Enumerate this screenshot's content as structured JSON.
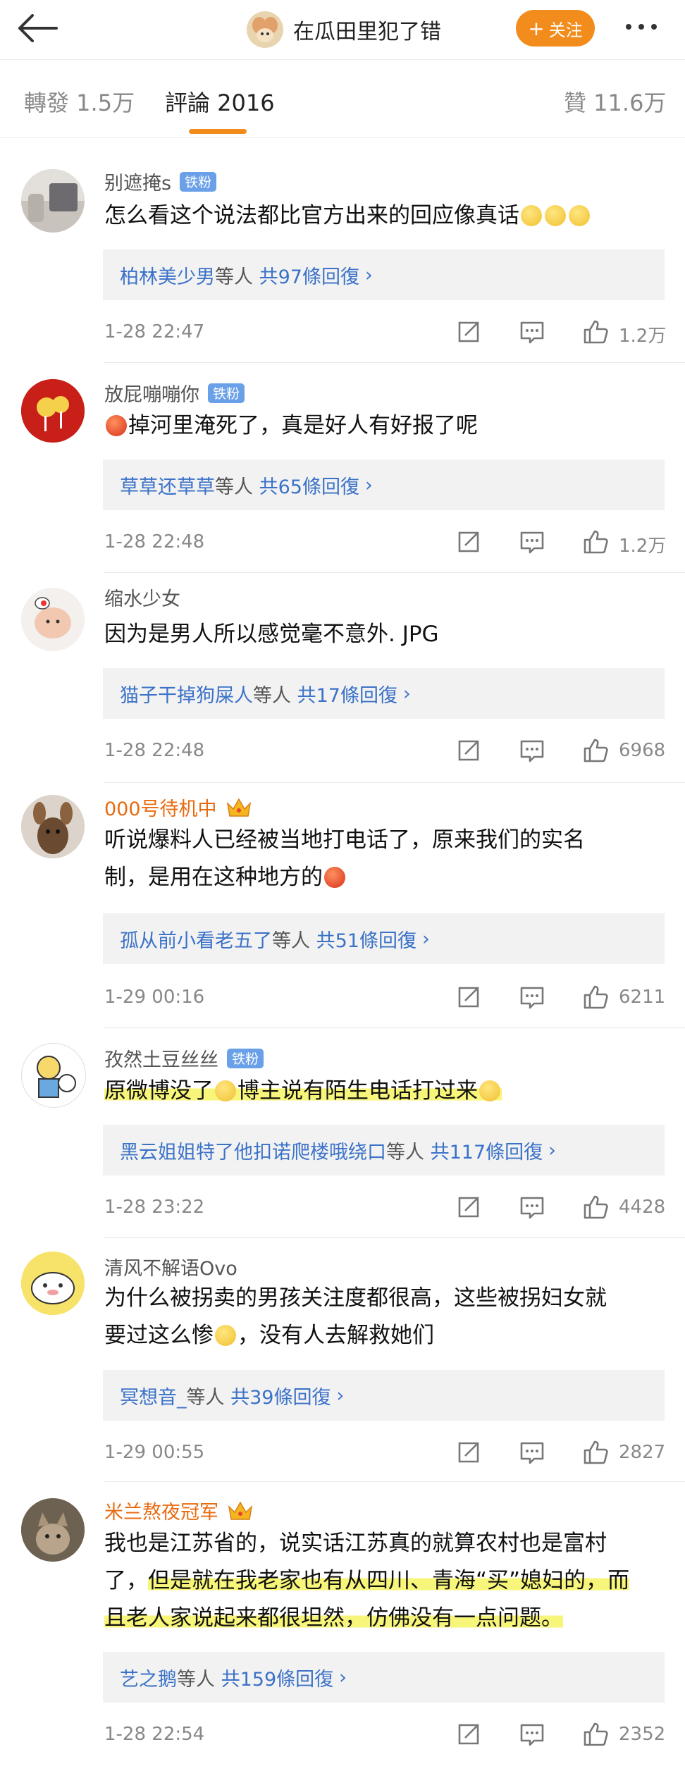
{
  "header": {
    "title": "在瓜田里犯了错",
    "follow_label": "关注"
  },
  "tabs": [
    {
      "label": "轉發 1.5万"
    },
    {
      "label": "評論 2016"
    },
    {
      "label": "贊 11.6万"
    }
  ],
  "comments": [
    {
      "user": "别遮掩s",
      "badge": "铁粉",
      "badge_type": "fan",
      "text": "怎么看这个说法都比官方出来的回应像真话",
      "reply_users": "柏林美少男",
      "reply_mid": "等人",
      "reply_count": "共97條回復",
      "time": "1-28 22:47",
      "likes": "1.2万"
    },
    {
      "user": "放屁嘣嘣你",
      "badge": "铁粉",
      "badge_type": "fan",
      "text": "掉河里淹死了，真是好人有好报了呢",
      "reply_users": "草草还草草",
      "reply_mid": "等人",
      "reply_count": "共65條回復",
      "time": "1-28 22:48",
      "likes": "1.2万"
    },
    {
      "user": "缩水少女",
      "badge": "",
      "text": "因为是男人所以感觉毫不意外. JPG",
      "reply_users": "猫子干掉狗屎人",
      "reply_mid": "等人",
      "reply_count": "共17條回復",
      "time": "1-28 22:48",
      "likes": "6968"
    },
    {
      "user": "000号待机中",
      "badge": "crown",
      "text_line1": "听说爆料人已经被当地打电话了，原来我们的实名",
      "text_line2": "制，是用在这种地方的",
      "reply_users": "孤从前小看老五了",
      "reply_mid": "等人",
      "reply_count": "共51條回復",
      "time": "1-29 00:16",
      "likes": "6211"
    },
    {
      "user": "孜然土豆丝丝",
      "badge": "铁粉",
      "badge_type": "fan",
      "text_a": "原微博没了",
      "text_b": "博主说有陌生电话打过来",
      "reply_users": "黑云姐姐特了他扣诺爬楼哦绕口",
      "reply_mid": "等人",
      "reply_count": "共117條回復",
      "time": "1-28 23:22",
      "likes": "4428"
    },
    {
      "user": "清风不解语Ovo",
      "badge": "",
      "text_line1": "为什么被拐卖的男孩关注度都很高，这些被拐妇女就",
      "text_line2a": "要过这么惨",
      "text_line2b": "，没有人去解救她们",
      "reply_users": "冥想音_",
      "reply_mid": "等人",
      "reply_count": "共39條回復",
      "time": "1-29 00:55",
      "likes": "2827"
    },
    {
      "user": "米兰熬夜冠军",
      "badge": "crown",
      "text_line1": "我也是江苏省的，说实话江苏真的就算农村也是富村",
      "text_line2a": "了，",
      "text_line2b": "但是就在我老家也有从四川、青海“买”媳妇的，而",
      "text_line3": "且老人家说起来都很坦然，仿佛没有一点问题。",
      "reply_users": "艺之鹅",
      "reply_mid": "等人",
      "reply_count": "共159條回復",
      "time": "1-28 22:54",
      "likes": "2352"
    }
  ],
  "colors": {
    "accent": "#f28c1c",
    "link": "#3b72c8",
    "highlight": "#f8f67a",
    "fan_badge": "#6aa0e8"
  }
}
